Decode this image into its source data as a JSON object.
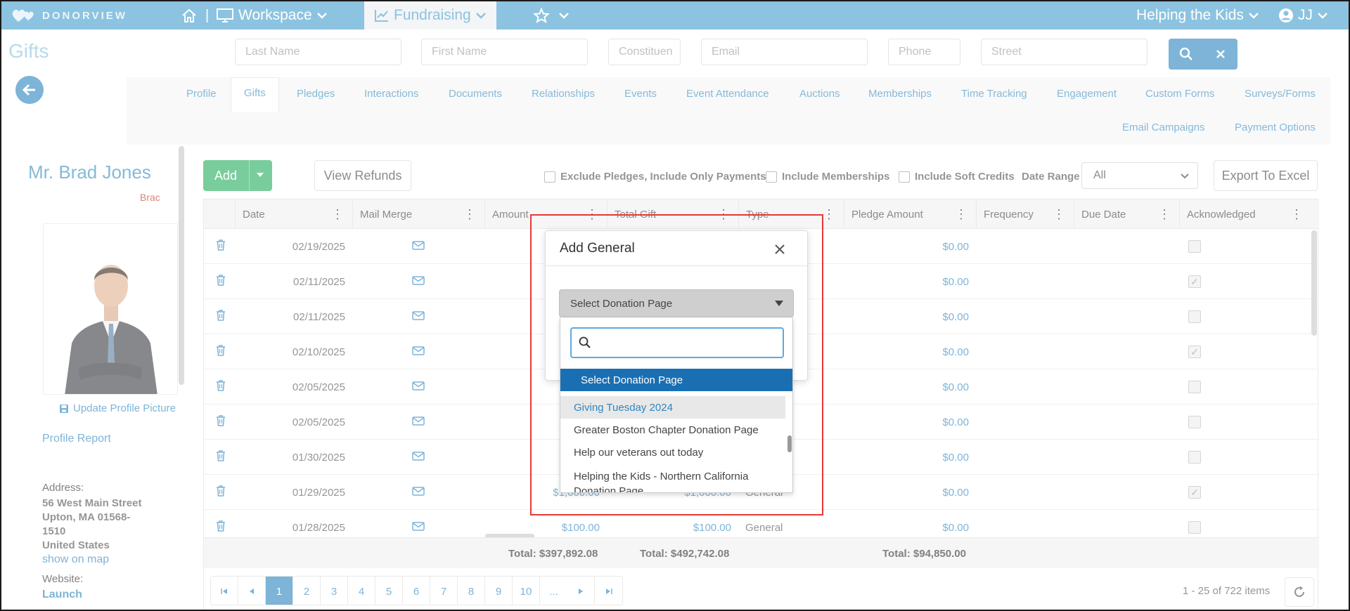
{
  "topnav": {
    "logo_text": "DONORVIEW",
    "workspace_label": "Workspace",
    "fundraising_label": "Fundraising",
    "org_label": "Helping the Kids",
    "user_initials": "JJ"
  },
  "page_title": "Gifts",
  "search": {
    "last_name_placeholder": "Last Name",
    "first_name_placeholder": "First Name",
    "constituent_placeholder": "Constituen",
    "email_placeholder": "Email",
    "phone_placeholder": "Phone",
    "street_placeholder": "Street"
  },
  "profile_tabs": [
    "Profile",
    "Gifts",
    "Pledges",
    "Interactions",
    "Documents",
    "Relationships",
    "Events",
    "Event Attendance",
    "Auctions",
    "Memberships",
    "Time Tracking",
    "Engagement",
    "Custom Forms",
    "Surveys/Forms",
    "Email Campaigns",
    "Payment Options"
  ],
  "profile": {
    "name": "Mr. Brad Jones",
    "nickname": "Brac",
    "update_picture": "Update Profile Picture",
    "profile_report": "Profile Report",
    "address_label": "Address:",
    "address_line1": "56 West Main Street",
    "address_line2": "Upton, MA 01568-",
    "address_line3": "1510",
    "address_country": "United States",
    "show_on_map": "show on map",
    "website_label": "Website:",
    "launch": "Launch"
  },
  "toolbar": {
    "add_label": "Add",
    "view_refunds": "View Refunds",
    "exclude_pledges": "Exclude Pledges, Include Only Payments",
    "include_memberships": "Include Memberships",
    "include_soft_credits": "Include Soft Credits",
    "date_range_label": "Date Range",
    "date_range_value": "All",
    "export": "Export To Excel"
  },
  "grid": {
    "columns": [
      "Date",
      "Mail Merge",
      "Amount",
      "Total Gift",
      "Type",
      "Pledge Amount",
      "Frequency",
      "Due Date",
      "Acknowledged"
    ],
    "rows": [
      {
        "date": "02/19/2025",
        "amount": "",
        "total": "",
        "type": "",
        "pledge": "$0.00",
        "ack": false
      },
      {
        "date": "02/11/2025",
        "amount": "",
        "total": "",
        "type": "",
        "pledge": "$0.00",
        "ack": true
      },
      {
        "date": "02/11/2025",
        "amount": "",
        "total": "",
        "type": "",
        "pledge": "$0.00",
        "ack": false
      },
      {
        "date": "02/10/2025",
        "amount": "",
        "total": "",
        "type": "",
        "pledge": "$0.00",
        "ack": true
      },
      {
        "date": "02/05/2025",
        "amount": "$",
        "total": "",
        "type": "",
        "pledge": "$0.00",
        "ack": false
      },
      {
        "date": "02/05/2025",
        "amount": "",
        "total": "",
        "type": "",
        "pledge": "$0.00",
        "ack": false
      },
      {
        "date": "01/30/2025",
        "amount": "$",
        "total": "",
        "type": "",
        "pledge": "$0.00",
        "ack": false
      },
      {
        "date": "01/29/2025",
        "amount": "$1,000.00",
        "total": "$1,000.00",
        "type": "General",
        "pledge": "$0.00",
        "ack": true
      },
      {
        "date": "01/28/2025",
        "amount": "$100.00",
        "total": "$100.00",
        "type": "General",
        "pledge": "$0.00",
        "ack": false
      }
    ],
    "totals": {
      "amount": "Total: $397,892.08",
      "total_gift": "Total: $492,742.08",
      "pledge": "Total: $94,850.00"
    }
  },
  "pager": {
    "pages": [
      "1",
      "2",
      "3",
      "4",
      "5",
      "6",
      "7",
      "8",
      "9",
      "10",
      "..."
    ],
    "current": "1",
    "info": "1 - 25 of 722 items"
  },
  "modal": {
    "title": "Add General",
    "select_value": "Select Donation Page",
    "options": [
      "Select Donation Page",
      "Giving Tuesday 2024",
      "Greater Boston Chapter Donation Page",
      "Help our veterans out today",
      "Helping the Kids - Northern California",
      "Donation Page"
    ]
  },
  "colors": {
    "nav_bg": "#8cc3e0",
    "primary": "#2e86c1",
    "add_green": "#27ae60",
    "dropdown_selected": "#1a6fb3",
    "highlight_border": "#e53935"
  }
}
